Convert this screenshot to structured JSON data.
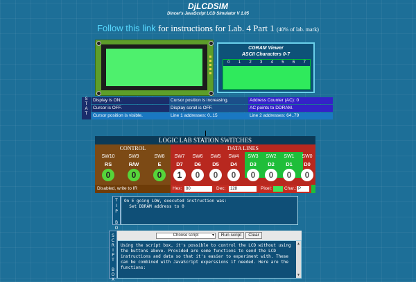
{
  "app": {
    "title": "DjLCDSIM",
    "subtitle": "Dincer's JavaScript LCD Simulator V 1.05"
  },
  "instructions": {
    "link_text": "Follow this link",
    "text": " for instructions for Lab. 4 Part 1 ",
    "note": "(40% of lab. mark)"
  },
  "cgram": {
    "title": "CGRAM Viewer",
    "subtitle": "ASCII Characters 0-7",
    "indices": [
      "0",
      "1",
      "2",
      "3",
      "4",
      "5",
      "6",
      "7"
    ]
  },
  "status": {
    "tab_label": "STATUS",
    "rows": [
      [
        "Display is ON.",
        "Cursor position is increasing.",
        "Address Counter (AC): 0"
      ],
      [
        "Cursor is OFF.",
        "Display scroll is OFF.",
        "AC points to DDRAM."
      ],
      [
        "Cursor position is visible.",
        "Line 1 addresses: 0..15",
        "Line 2 addresses: 64..79"
      ]
    ],
    "colors": {
      "col1_bg": "#1a2d6b",
      "col2_bg": "#1b4f8a",
      "col3_bg": "#3422c8",
      "row3_bg": "#1a78c2"
    }
  },
  "logic": {
    "title": "LOGIC LAB STATION SWITCHES",
    "control_title": "CONTROL",
    "data_title": "DATA LINES",
    "control_switches": [
      {
        "sw": "SW10",
        "pin": "RS",
        "value": "0"
      },
      {
        "sw": "SW9",
        "pin": "R/W",
        "value": "0"
      },
      {
        "sw": "SW8",
        "pin": "E",
        "value": "0"
      }
    ],
    "data_switches": [
      {
        "sw": "SW7",
        "pin": "D7",
        "value": "1"
      },
      {
        "sw": "SW6",
        "pin": "D6",
        "value": "0"
      },
      {
        "sw": "SW5",
        "pin": "D5",
        "value": "0"
      },
      {
        "sw": "SW4",
        "pin": "D4",
        "value": "0"
      },
      {
        "sw": "SW3",
        "pin": "D3",
        "value": "0"
      },
      {
        "sw": "SW2",
        "pin": "D2",
        "value": "0"
      },
      {
        "sw": "SW1",
        "pin": "D1",
        "value": "0"
      },
      {
        "sw": "SW0",
        "pin": "D0",
        "value": "0"
      }
    ],
    "control_status": "Disabled, write to IR",
    "hex_label": "Hex:",
    "hex_value": "80",
    "dec_label": "Dec:",
    "dec_value": "128",
    "pixel_label": "Pixel:",
    "char_label": "Char.:",
    "char_value": "P"
  },
  "tip": {
    "tab_label": "TIP BOX",
    "text": "On E going LOW, executed instruction was:\n  Set DDRAM address to 0"
  },
  "script": {
    "tab_label": "SCRIPT BOX",
    "select_value": "Choose script",
    "run_label": "Run script",
    "clear_label": "Clear",
    "text": "Using the script box, it's possible to control the LCD without using the buttons above. Provided are some functions to send the LCD instructions and data so that it's easier to experiment with. These can be combined with JavaScript experssions if needed. Here are the functions:"
  }
}
